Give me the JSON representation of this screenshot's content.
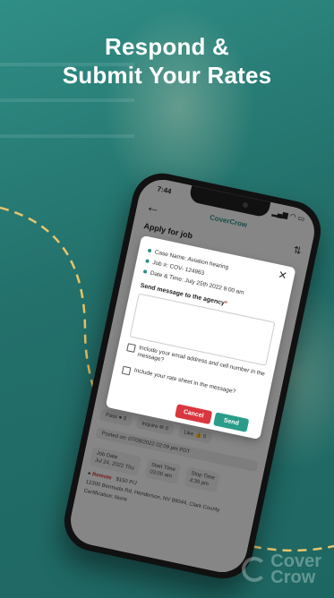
{
  "hero": {
    "headline_line1": "Respond &",
    "headline_line2": "Submit Your Rates"
  },
  "brand": {
    "name_line1": "Cover",
    "name_line2": "Crow"
  },
  "phone": {
    "status_time": "7:44",
    "status_icons": "▂▄▆ ◠ ▭",
    "app_logo": "CoverCrow",
    "page_title": "Apply for job",
    "dialog": {
      "case_name": "Case Name: Aviation hearing",
      "job_number": "Job #: COV- 124963",
      "date_time": "Date & Time: July 25th 2022 9:00 am",
      "message_label": "Send message to the agency",
      "required_mark": "*",
      "message_value": "",
      "option_contact": "Include your email address and cell number in the message?",
      "option_rate_sheet": "Include your rate sheet in the message?",
      "cancel_label": "Cancel",
      "send_label": "Send"
    },
    "background_card": {
      "chip_pass": "Pass",
      "chip_pass_count": "0",
      "chip_inquire": "Inquire",
      "chip_inquire_count": "0",
      "chip_like": "Like",
      "chip_like_count": "0",
      "posted": "Posted on: 07/08/2022 02:09 pm PDT",
      "job_date_label": "Job Date",
      "job_date_value": "Jul 24, 2022 Thu",
      "start_time_label": "Start Time",
      "start_time_value": "03:00 am",
      "stop_time_label": "Stop Time",
      "stop_time_value": "4:30 pm",
      "location_type": "Remote",
      "rate": "$150 P/J",
      "address": "12300 Bermuda Rd, Henderson, NV 89044, Clark County",
      "certification": "Certification: None"
    }
  },
  "colors": {
    "background_teal": "#2f8e86",
    "accent_yellow": "#e8c56a",
    "cancel_red": "#d9363e",
    "send_green": "#2a9d8a"
  }
}
